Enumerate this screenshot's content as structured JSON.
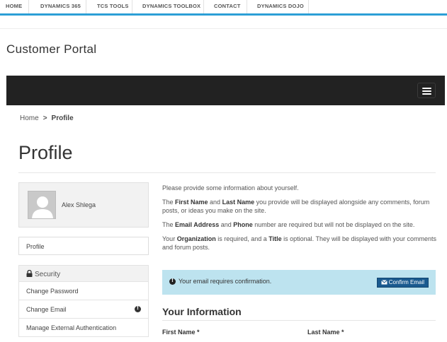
{
  "nav": {
    "items": [
      {
        "label": "HOME"
      },
      {
        "label": "DYNAMICS 365"
      },
      {
        "label": "TCS TOOLS"
      },
      {
        "label": "DYNAMICS TOOLBOX"
      },
      {
        "label": "CONTACT"
      },
      {
        "label": "DYNAMICS DOJO"
      }
    ]
  },
  "site": {
    "title": "Customer Portal"
  },
  "breadcrumb": {
    "home": "Home",
    "separator": ">",
    "current": "Profile"
  },
  "page": {
    "title": "Profile"
  },
  "sidebar": {
    "user_name": "Alex Shlega",
    "profile_label": "Profile",
    "security_label": "Security",
    "items": [
      {
        "label": "Change Password"
      },
      {
        "label": "Change Email",
        "icon": "exclamation-circle-icon"
      },
      {
        "label": "Manage External Authentication"
      }
    ]
  },
  "intro": {
    "p1": "Please provide some information about yourself.",
    "p2": {
      "pre": "The ",
      "b1": "First Name",
      "mid1": " and ",
      "b2": "Last Name",
      "post": " you provide will be displayed alongside any comments, forum posts, or ideas you make on the site."
    },
    "p3": {
      "pre": "The ",
      "b1": "Email Address",
      "mid1": " and ",
      "b2": "Phone",
      "post": " number are required but will not be displayed on the site."
    },
    "p4": {
      "pre": "Your ",
      "b1": "Organization",
      "mid1": " is required, and a ",
      "b2": "Title",
      "post": " is optional. They will be displayed with your comments and forum posts."
    }
  },
  "alert": {
    "text": "Your email requires confirmation.",
    "button": "Confirm Email",
    "background": "#bde3ef"
  },
  "form": {
    "section_title": "Your Information",
    "first_name_label": "First Name *",
    "last_name_label": "Last Name *"
  },
  "colors": {
    "accent": "#2c9fd6",
    "dark_bar": "#222222",
    "button": "#1a5a8f"
  }
}
